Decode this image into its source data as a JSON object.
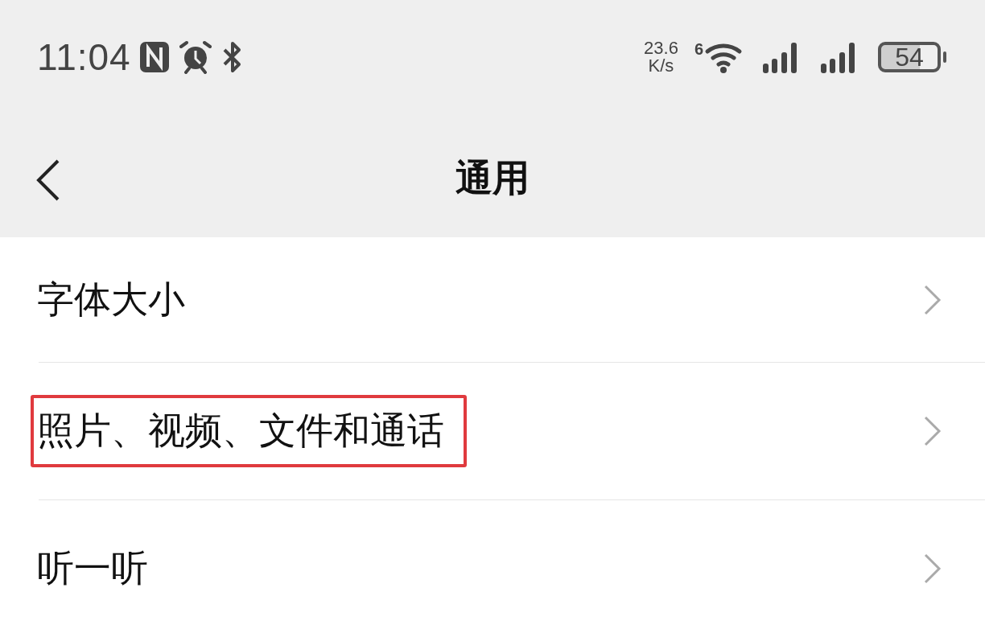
{
  "status_bar": {
    "time": "11:04",
    "net_speed": "23.6",
    "net_unit": "K/s",
    "wifi_badge": "6",
    "battery": "54"
  },
  "header": {
    "title": "通用"
  },
  "items": [
    {
      "label": "字体大小",
      "highlighted": false
    },
    {
      "label": "照片、视频、文件和通话",
      "highlighted": true
    },
    {
      "label": "听一听",
      "highlighted": false
    }
  ]
}
